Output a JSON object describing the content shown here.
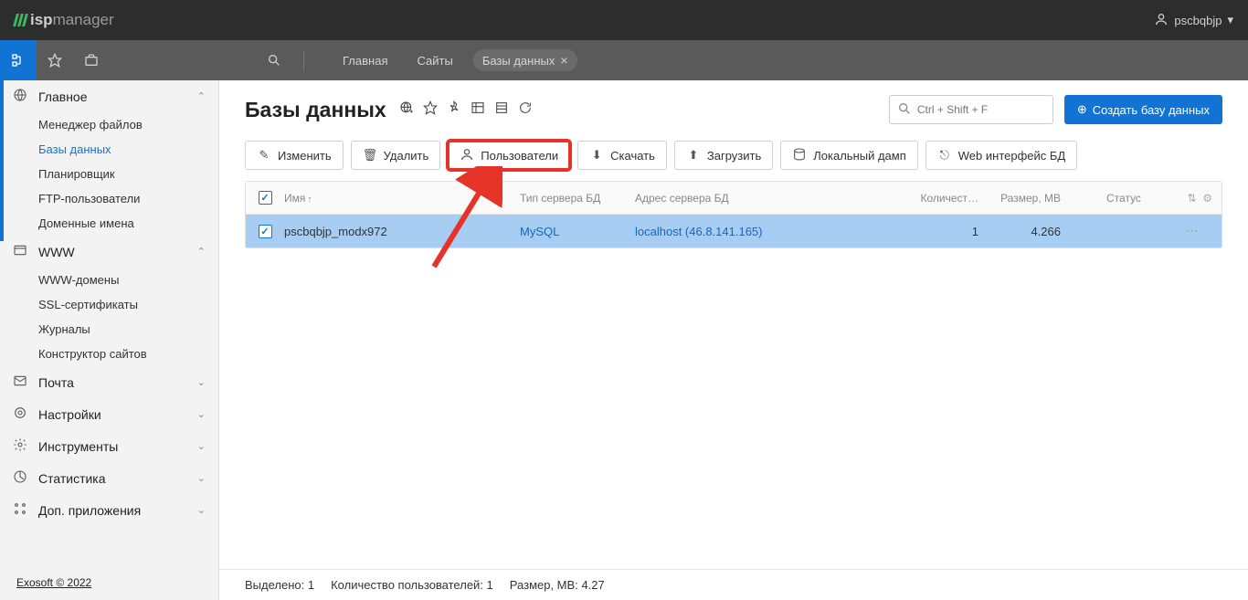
{
  "header": {
    "logo_parts": {
      "prefix": "isp",
      "suffix": "manager"
    },
    "user_name": "pscbqbjp"
  },
  "breadcrumbs": {
    "home": "Главная",
    "sites": "Сайты",
    "databases": "Базы данных"
  },
  "sidebar": {
    "sections": [
      {
        "label": "Главное",
        "expanded": true,
        "items": [
          "Менеджер файлов",
          "Базы данных",
          "Планировщик",
          "FTP-пользователи",
          "Доменные имена"
        ],
        "active_index": 1
      },
      {
        "label": "WWW",
        "expanded": true,
        "items": [
          "WWW-домены",
          "SSL-сертификаты",
          "Журналы",
          "Конструктор сайтов"
        ]
      },
      {
        "label": "Почта",
        "expanded": false
      },
      {
        "label": "Настройки",
        "expanded": false
      },
      {
        "label": "Инструменты",
        "expanded": false
      },
      {
        "label": "Статистика",
        "expanded": false
      },
      {
        "label": "Доп. приложения",
        "expanded": false
      }
    ],
    "footer": "Exosoft © 2022"
  },
  "page": {
    "title": "Базы данных",
    "search_placeholder": "Ctrl + Shift + F",
    "create_btn": "Создать базу данных"
  },
  "actions": {
    "edit": "Изменить",
    "delete": "Удалить",
    "users": "Пользователи",
    "download": "Скачать",
    "upload": "Загрузить",
    "dump": "Локальный дамп",
    "web_ui": "Web интерфейс БД"
  },
  "table": {
    "headers": {
      "name": "Имя",
      "type": "Тип сервера БД",
      "server": "Адрес сервера БД",
      "count": "Количест…",
      "size": "Размер, MB",
      "status": "Статус"
    },
    "rows": [
      {
        "name": "pscbqbjp_modx972",
        "type": "MySQL",
        "server": "localhost (46.8.141.165)",
        "count": "1",
        "size": "4.266",
        "status": ""
      }
    ]
  },
  "footer": {
    "selected_label": "Выделено:",
    "selected_count": "1",
    "users_label": "Количество пользователей:",
    "users_count": "1",
    "size_label": "Размер, MB:",
    "size_value": "4.27"
  }
}
